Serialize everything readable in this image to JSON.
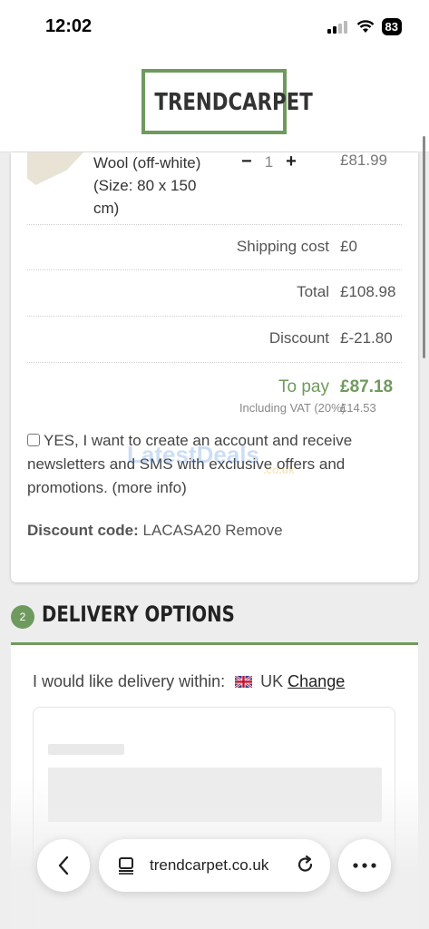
{
  "status": {
    "time": "12:02",
    "battery": "83"
  },
  "header": {
    "logo_text": "TRENDCARPET"
  },
  "cart": {
    "item_desc": "Wool (off-white) (Size: 80 x 150 cm)",
    "quantity": "1",
    "line_price": "£81.99",
    "rows": [
      {
        "label": "Shipping cost",
        "value": "£0"
      },
      {
        "label": "Total",
        "value": "£108.98"
      },
      {
        "label": "Discount",
        "value": "£-21.80"
      }
    ],
    "to_pay_label": "To pay",
    "to_pay_value": "£87.18",
    "vat_label": "Including VAT (20%)",
    "vat_value": "£14.53",
    "newsletter_text": "YES, I want to create an account and receive newsletters and SMS with exclusive offers and promotions. (more info)",
    "discount_label": "Discount code:",
    "discount_code": "LACASA20",
    "remove_label": "Remove"
  },
  "delivery": {
    "step": "2",
    "title": "DELIVERY OPTIONS",
    "within_label": "I would like delivery within:",
    "country": "UK",
    "change_label": "Change"
  },
  "browser": {
    "url": "trendcarpet.co.uk"
  },
  "colors": {
    "accent": "#6f9a5e"
  }
}
